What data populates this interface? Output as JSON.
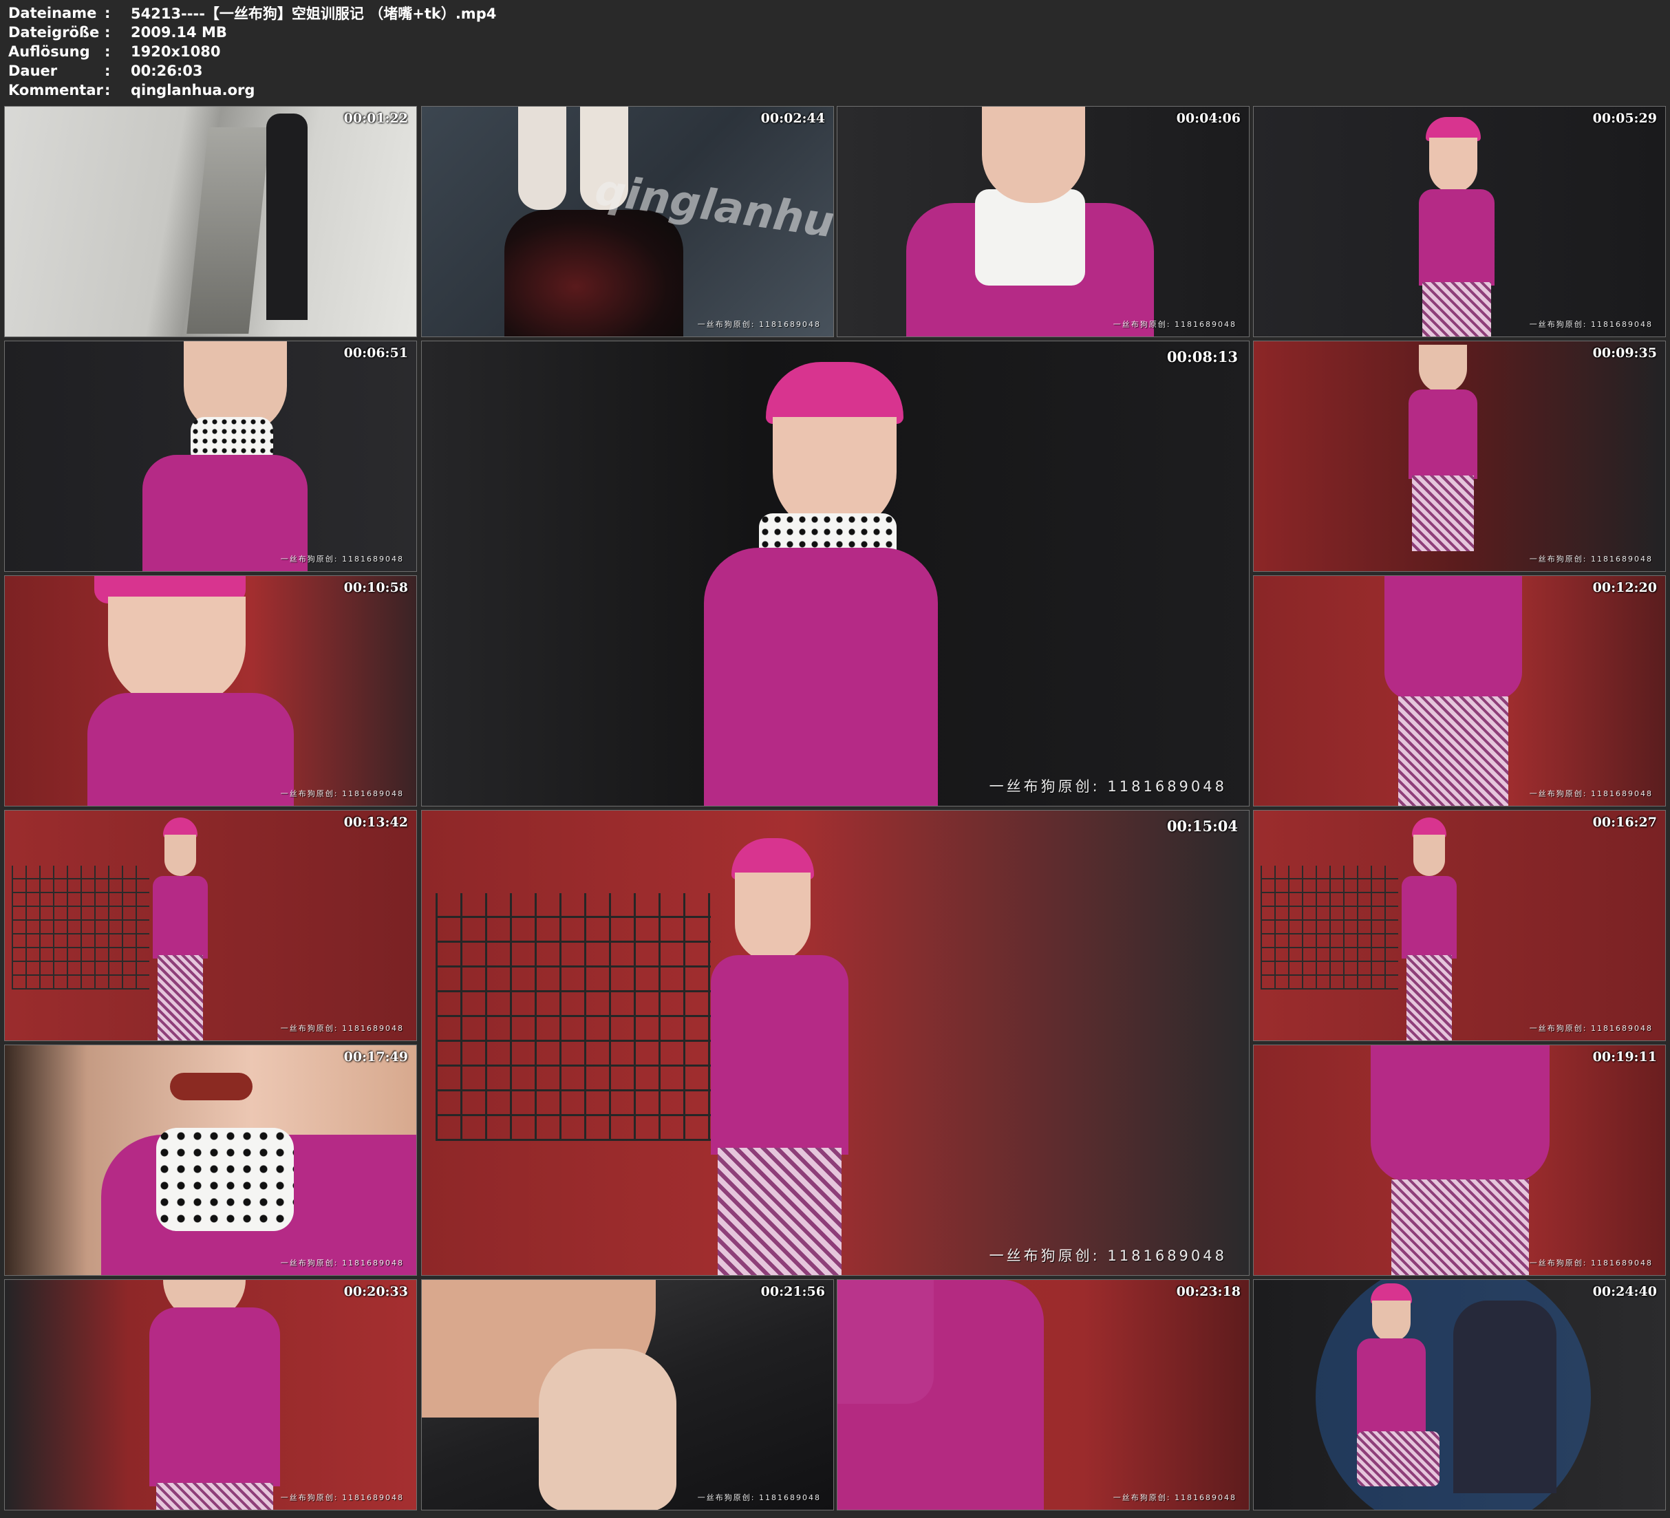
{
  "info": {
    "rows": [
      {
        "label": "Dateiname",
        "sep": ":",
        "value": "54213----【一丝布狗】空姐训服记 （堵嘴+tk）.mp4"
      },
      {
        "label": "Dateigröße",
        "sep": ":",
        "value": "2009.14 MB"
      },
      {
        "label": "Auflösung",
        "sep": ":",
        "value": "1920x1080"
      },
      {
        "label": "Dauer",
        "sep": ":",
        "value": "00:26:03"
      },
      {
        "label": "Kommentar",
        "sep": ":",
        "value": "qinglanhua.org"
      }
    ]
  },
  "thumbnails": [
    {
      "time": "00:01:22",
      "caption": ""
    },
    {
      "time": "00:02:44",
      "caption": "一丝布狗原创: 1181689048"
    },
    {
      "time": "00:04:06",
      "caption": "一丝布狗原创: 1181689048"
    },
    {
      "time": "00:05:29",
      "caption": "一丝布狗原创: 1181689048"
    },
    {
      "time": "00:06:51",
      "caption": "一丝布狗原创: 1181689048"
    },
    {
      "time": "00:08:13",
      "caption": "一丝布狗原创: 1181689048"
    },
    {
      "time": "00:09:35",
      "caption": "一丝布狗原创: 1181689048"
    },
    {
      "time": "00:10:58",
      "caption": "一丝布狗原创: 1181689048"
    },
    {
      "time": "00:12:20",
      "caption": "一丝布狗原创: 1181689048"
    },
    {
      "time": "00:13:42",
      "caption": "一丝布狗原创: 1181689048"
    },
    {
      "time": "00:15:04",
      "caption": "一丝布狗原创: 1181689048"
    },
    {
      "time": "00:16:27",
      "caption": "一丝布狗原创: 1181689048"
    },
    {
      "time": "00:17:49",
      "caption": "一丝布狗原创: 1181689048"
    },
    {
      "time": "00:19:11",
      "caption": "一丝布狗原创: 1181689048"
    },
    {
      "time": "00:20:33",
      "caption": "一丝布狗原创: 1181689048"
    },
    {
      "time": "00:21:56",
      "caption": "一丝布狗原创: 1181689048"
    },
    {
      "time": "00:23:18",
      "caption": "一丝布狗原创: 1181689048"
    },
    {
      "time": "00:24:40",
      "caption": ""
    }
  ],
  "watermark": "qinglanhua.net"
}
